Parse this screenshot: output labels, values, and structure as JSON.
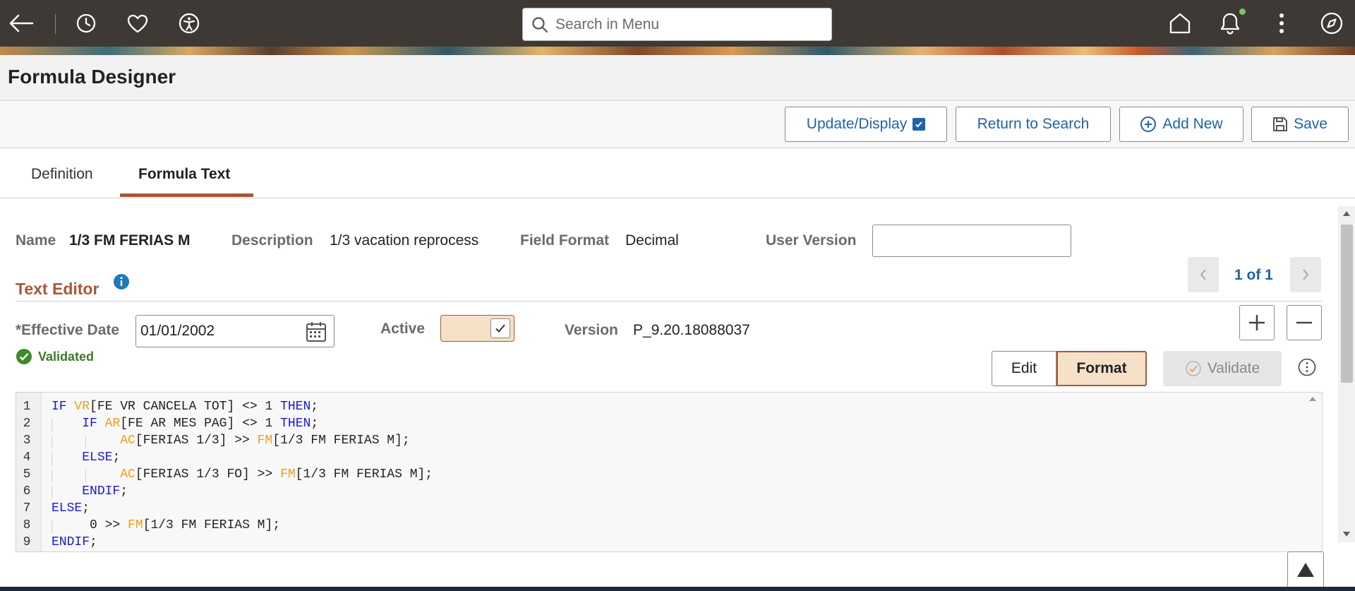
{
  "header": {
    "search_placeholder": "Search in Menu",
    "icons": [
      "back-arrow-icon",
      "history-icon",
      "favorites-heart-icon",
      "accessibility-icon",
      "home-icon",
      "bell-icon",
      "more-vertical-icon",
      "navigator-compass-icon"
    ],
    "notification_dot_color": "#7cc36b"
  },
  "page": {
    "title": "Formula Designer"
  },
  "toolbar": {
    "update_display": "Update/Display",
    "update_display_checked": true,
    "return_to_search": "Return to Search",
    "add_new": "Add New",
    "save": "Save"
  },
  "tabs": [
    {
      "label": "Definition",
      "active": false
    },
    {
      "label": "Formula Text",
      "active": true
    }
  ],
  "fields": {
    "name_label": "Name",
    "name_value": "1/3 FM FERIAS M",
    "description_label": "Description",
    "description_value": "1/3 vacation reprocess",
    "field_format_label": "Field Format",
    "field_format_value": "Decimal",
    "user_version_label": "User Version",
    "user_version_value": ""
  },
  "text_editor": {
    "title": "Text Editor",
    "pagination": "1 of 1",
    "effective_date_label": "*Effective Date",
    "effective_date_value": "01/01/2002",
    "active_label": "Active",
    "active_checked": true,
    "version_label": "Version",
    "version_value": "P_9.20.18088037",
    "validated_text": "Validated",
    "edit_button": "Edit",
    "format_button": "Format",
    "validate_button": "Validate"
  },
  "code": {
    "line_numbers": [
      "1",
      "2",
      "3",
      "4",
      "5",
      "6",
      "7",
      "8",
      "9"
    ],
    "lines": [
      "IF VR[FE VR CANCELA TOT] <> 1 THEN;",
      "    IF AR[FE AR MES PAG] <> 1 THEN;",
      "         AC[FERIAS 1/3] >> FM[1/3 FM FERIAS M];",
      "    ELSE;",
      "         AC[FERIAS 1/3 FO] >> FM[1/3 FM FERIAS M];",
      "    ENDIF;",
      "ELSE;",
      "     0 >> FM[1/3 FM FERIAS M];",
      "ENDIF;"
    ]
  },
  "colors": {
    "accent": "#a8583a",
    "link": "#1e63a8",
    "keyword": "#1a1acc",
    "function": "#e8a317",
    "success": "#3e7a25"
  }
}
